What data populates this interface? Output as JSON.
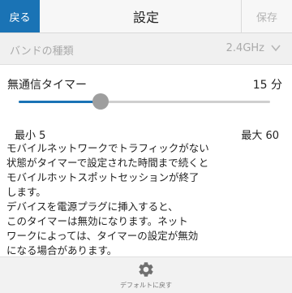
{
  "header": {
    "back_label": "戻る",
    "title": "設定",
    "save_label": "保存"
  },
  "band": {
    "label": "バンドの種類",
    "value": "2.4GHz"
  },
  "timer": {
    "label": "無通信タイマー",
    "value": "15 分",
    "slider_value": 15,
    "slider_min": 5,
    "slider_max": 60,
    "min_label": "最小 5",
    "max_label": "最大 60"
  },
  "description": "モバイルネットワークでトラフィックがない\n状態がタイマーで設定された時間まで続くと\nモバイルホットスポットセッションが終了\nします。\nデバイスを電源プラグに挿入すると、\nこのタイマーは無効になります。ネット\nワークによっては、タイマーの設定が無効\nになる場合があります。",
  "footer": {
    "reset_label": "デフォルトに戻す"
  },
  "colors": {
    "accent": "#1a73b5",
    "thumb": "#9e9e9e",
    "disabled_text": "#aaaaaa"
  },
  "icons": {
    "band": "chevron-down-icon",
    "reset": "gear-icon"
  }
}
